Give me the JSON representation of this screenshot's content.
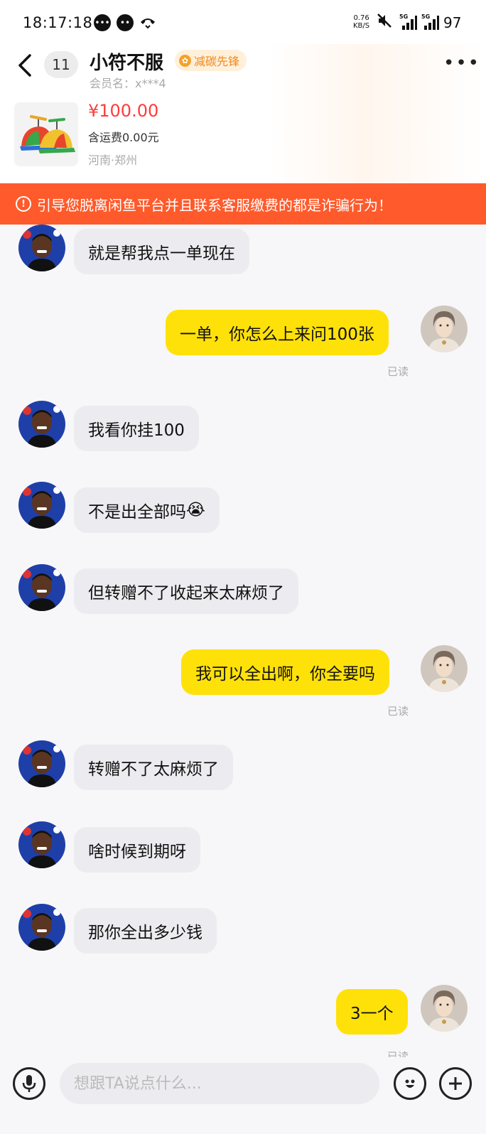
{
  "status_bar": {
    "time": "18:17:18",
    "net_speed_value": "0.76",
    "net_speed_unit": "KB/S",
    "signal_1": "5G",
    "signal_2": "5G",
    "battery": "97",
    "icons": [
      "message-icon",
      "chat-icon",
      "call-icon",
      "mute-icon",
      "signal-icon",
      "signal-icon"
    ]
  },
  "header": {
    "unread_count": "11",
    "seller_name": "小符不服",
    "badge_label": "减碳先锋",
    "member_label": "会员名：x***4",
    "more_icon": "more-dots-icon"
  },
  "goods": {
    "price": "¥100.00",
    "shipping": "含运费0.00元",
    "location": "河南·郑州"
  },
  "warning": {
    "text": "引导您脱离闲鱼平台并且联系客服缴费的都是诈骗行为！"
  },
  "messages": [
    {
      "side": "in",
      "text": "就是帮我点一单现在"
    },
    {
      "side": "out",
      "text": "一单，你怎么上来问100张",
      "read": "已读"
    },
    {
      "side": "in",
      "text": "我看你挂100"
    },
    {
      "side": "in",
      "text": "不是出全部吗",
      "emoji": "😭"
    },
    {
      "side": "in",
      "text": "但转赠不了收起来太麻烦了"
    },
    {
      "side": "out",
      "text": "我可以全出啊，你全要吗",
      "read": "已读"
    },
    {
      "side": "in",
      "text": "转赠不了太麻烦了"
    },
    {
      "side": "in",
      "text": "啥时候到期呀"
    },
    {
      "side": "in",
      "text": "那你全出多少钱"
    },
    {
      "side": "out",
      "text": "3一个",
      "read": "已读"
    }
  ],
  "input": {
    "placeholder": "想跟TA说点什么..."
  },
  "colors": {
    "warning_bg": "#ff5a2b",
    "outgoing_bubble": "#ffe10a",
    "incoming_bubble": "#ececf0",
    "price": "#ff3b3b",
    "badge": "#f08a1c"
  }
}
